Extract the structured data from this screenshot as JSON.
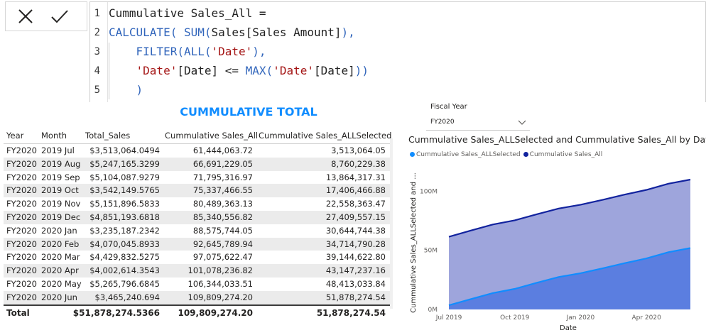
{
  "formula_bar": {
    "cancel_icon": "close-icon",
    "commit_icon": "checkmark-icon",
    "lines": [
      {
        "n": "1",
        "tokens": [
          {
            "t": "Cummulative Sales_All =",
            "k": "plain"
          }
        ]
      },
      {
        "n": "2",
        "tokens": [
          {
            "t": "CALCULATE(",
            "k": "fn"
          },
          {
            "t": " ",
            "k": "plain"
          },
          {
            "t": "SUM(",
            "k": "fn"
          },
          {
            "t": "Sales[Sales Amount]",
            "k": "plain"
          },
          {
            "t": "),",
            "k": "fn"
          }
        ]
      },
      {
        "n": "3",
        "tokens": [
          {
            "t": "    ",
            "k": "plain"
          },
          {
            "t": "FILTER(",
            "k": "fn"
          },
          {
            "t": "ALL(",
            "k": "fn"
          },
          {
            "t": "'Date'",
            "k": "str"
          },
          {
            "t": "),",
            "k": "fn"
          }
        ]
      },
      {
        "n": "4",
        "tokens": [
          {
            "t": "    ",
            "k": "plain"
          },
          {
            "t": "'Date'",
            "k": "str"
          },
          {
            "t": "[Date] <= ",
            "k": "plain"
          },
          {
            "t": "MAX(",
            "k": "fn"
          },
          {
            "t": "'Date'",
            "k": "str"
          },
          {
            "t": "[Date]",
            "k": "plain"
          },
          {
            "t": "))",
            "k": "fn"
          }
        ]
      },
      {
        "n": "5",
        "tokens": [
          {
            "t": "    ",
            "k": "plain"
          },
          {
            "t": ")",
            "k": "fn"
          }
        ]
      }
    ]
  },
  "table": {
    "title": "CUMMULATIVE TOTAL",
    "columns": [
      "Year",
      "Month",
      "Total_Sales",
      "Cummulative Sales_All",
      "Cummulative Sales_ALLSelected"
    ],
    "rows": [
      [
        "FY2020",
        "2019 Jul",
        "$3,513,064.0494",
        "61,444,063.72",
        "3,513,064.05"
      ],
      [
        "FY2020",
        "2019 Aug",
        "$5,247,165.3299",
        "66,691,229.05",
        "8,760,229.38"
      ],
      [
        "FY2020",
        "2019 Sep",
        "$5,104,087.9279",
        "71,795,316.97",
        "13,864,317.31"
      ],
      [
        "FY2020",
        "2019 Oct",
        "$3,542,149.5765",
        "75,337,466.55",
        "17,406,466.88"
      ],
      [
        "FY2020",
        "2019 Nov",
        "$5,151,896.5833",
        "80,489,363.13",
        "22,558,363.47"
      ],
      [
        "FY2020",
        "2019 Dec",
        "$4,851,193.6818",
        "85,340,556.82",
        "27,409,557.15"
      ],
      [
        "FY2020",
        "2020 Jan",
        "$3,235,187.2342",
        "88,575,744.05",
        "30,644,744.38"
      ],
      [
        "FY2020",
        "2020 Feb",
        "$4,070,045.8933",
        "92,645,789.94",
        "34,714,790.28"
      ],
      [
        "FY2020",
        "2020 Mar",
        "$4,429,832.5275",
        "97,075,622.47",
        "39,144,622.80"
      ],
      [
        "FY2020",
        "2020 Apr",
        "$4,002,614.3543",
        "101,078,236.82",
        "43,147,237.16"
      ],
      [
        "FY2020",
        "2020 May",
        "$5,265,796.6845",
        "106,344,033.51",
        "48,413,033.84"
      ],
      [
        "FY2020",
        "2020 Jun",
        "$3,465,240.694",
        "109,809,274.20",
        "51,878,274.54"
      ]
    ],
    "total": {
      "label": "Total",
      "total_sales": "$51,878,274.5366",
      "cum_all": "109,809,274.20",
      "cum_allselected": "51,878,274.54"
    }
  },
  "slicer": {
    "label": "Fiscal Year",
    "value": "FY2020",
    "icon": "chevron-down-icon"
  },
  "chart_data": {
    "type": "area",
    "title": "Cummulative Sales_ALLSelected and Cummulative Sales_All by Date",
    "xlabel": "Date",
    "ylabel": "Cummulative Sales_ALLSelected and ...",
    "x": [
      "2019-07",
      "2019-08",
      "2019-09",
      "2019-10",
      "2019-11",
      "2019-12",
      "2020-01",
      "2020-02",
      "2020-03",
      "2020-04",
      "2020-05",
      "2020-06"
    ],
    "x_tick_labels": [
      "Jul 2019",
      "Oct 2019",
      "Jan 2020",
      "Apr 2020"
    ],
    "y_tick_labels": [
      "0M",
      "50M",
      "100M"
    ],
    "ylim": [
      0,
      120000000
    ],
    "legend_position": "top-left",
    "grid": false,
    "series": [
      {
        "name": "Cummulative Sales_ALLSelected",
        "color": "#118dff",
        "values": [
          3513064.05,
          8760229.38,
          13864317.31,
          17406466.88,
          22558363.47,
          27409557.15,
          30644744.38,
          34714790.28,
          39144622.8,
          43147237.16,
          48413033.84,
          51878274.54
        ]
      },
      {
        "name": "Cummulative Sales_All",
        "color": "#12239e",
        "values": [
          61444063.72,
          66691229.05,
          71795316.97,
          75337466.55,
          80489363.13,
          85340556.82,
          88575744.05,
          92645789.94,
          97075622.47,
          101078236.82,
          106344033.51,
          109809274.2
        ]
      }
    ]
  }
}
